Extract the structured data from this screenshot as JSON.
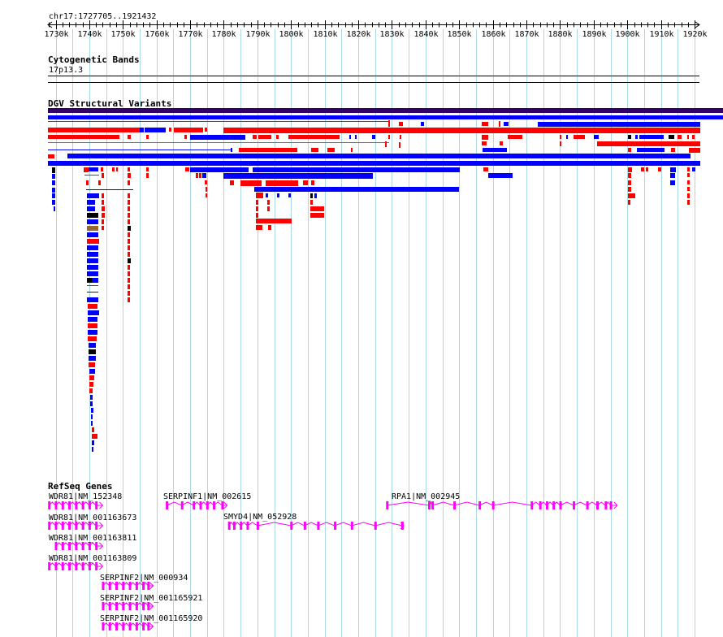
{
  "region": "chr17:1727705..1921432",
  "axis": {
    "start": 1727705,
    "end": 1921432,
    "ticks": [
      "1730k",
      "1740k",
      "1750k",
      "1760k",
      "1770k",
      "1780k",
      "1790k",
      "1800k",
      "1810k",
      "1820k",
      "1830k",
      "1840k",
      "1850k",
      "1860k",
      "1870k",
      "1880k",
      "1890k",
      "1900k",
      "1910k",
      "1920k"
    ]
  },
  "colors": {
    "grid": "#add8e6",
    "gain": "#ff0000",
    "loss": "#0000ff",
    "complex": "#000000",
    "inversion": "#996633",
    "band": "#330066",
    "gene": "#ff00ff"
  },
  "cytoband": {
    "title": "Cytogenetic Bands",
    "band": "17p13.3"
  },
  "dgv": {
    "title": "DGV Structural Variants"
  },
  "refseq": {
    "title": "RefSeq Genes",
    "genes": [
      {
        "label": "WDR81|NM_152348",
        "start": 1728000,
        "end": 1744000,
        "exons": [
          1728000,
          1730000,
          1732000,
          1734000,
          1736000,
          1738000,
          1740000,
          1742000
        ]
      },
      {
        "label": "SERPINF1|NM_002615",
        "start": 1763000,
        "end": 1781000,
        "exons": [
          1763000,
          1767500,
          1771000,
          1773000,
          1775000,
          1777000,
          1779500
        ]
      },
      {
        "label": "RPA1|NM_002945",
        "start": 1828500,
        "end": 1897000,
        "exons": [
          1828500,
          1841000,
          1842000,
          1848500,
          1856000,
          1860000,
          1871500,
          1874000,
          1876000,
          1878000,
          1880000,
          1884000,
          1888000,
          1891000,
          1893500,
          1895000
        ]
      },
      {
        "label": "WDR81|NM_001163673",
        "start": 1728000,
        "end": 1744000,
        "exons": [
          1728000,
          1730000,
          1732000,
          1734000,
          1736000,
          1738000,
          1740000,
          1742000
        ]
      },
      {
        "label": "SMYD4|NM_052928",
        "start": 1781500,
        "end": 1833500,
        "exons": [
          1781500,
          1783000,
          1785000,
          1787000,
          1790000,
          1800000,
          1804000,
          1808000,
          1813000,
          1818000,
          1825000,
          1833000
        ]
      },
      {
        "label": "WDR81|NM_001163811",
        "start": 1728000,
        "end": 1744000,
        "exons": [
          1730000,
          1732000,
          1734000,
          1736000,
          1738000,
          1740000,
          1742000
        ]
      },
      {
        "label": "WDR81|NM_001163809",
        "start": 1728000,
        "end": 1744000,
        "exons": [
          1728000,
          1730000,
          1732000,
          1734000,
          1736000,
          1738000,
          1740000,
          1742000
        ]
      },
      {
        "label": "SERPINF2|NM_000934",
        "start": 1744000,
        "end": 1759000,
        "exons": [
          1744000,
          1746000,
          1748000,
          1750000,
          1752000,
          1754000,
          1756000,
          1757500
        ]
      },
      {
        "label": "SERPINF2|NM_001165921",
        "start": 1744000,
        "end": 1759000,
        "exons": [
          1744000,
          1746000,
          1748000,
          1750000,
          1752000,
          1754000,
          1756000,
          1757500
        ]
      },
      {
        "label": "SERPINF2|NM_001165920",
        "start": 1744000,
        "end": 1759000,
        "exons": [
          1744000,
          1746000,
          1748000,
          1750000,
          1752000,
          1754000,
          1756000,
          1757500
        ]
      }
    ]
  }
}
